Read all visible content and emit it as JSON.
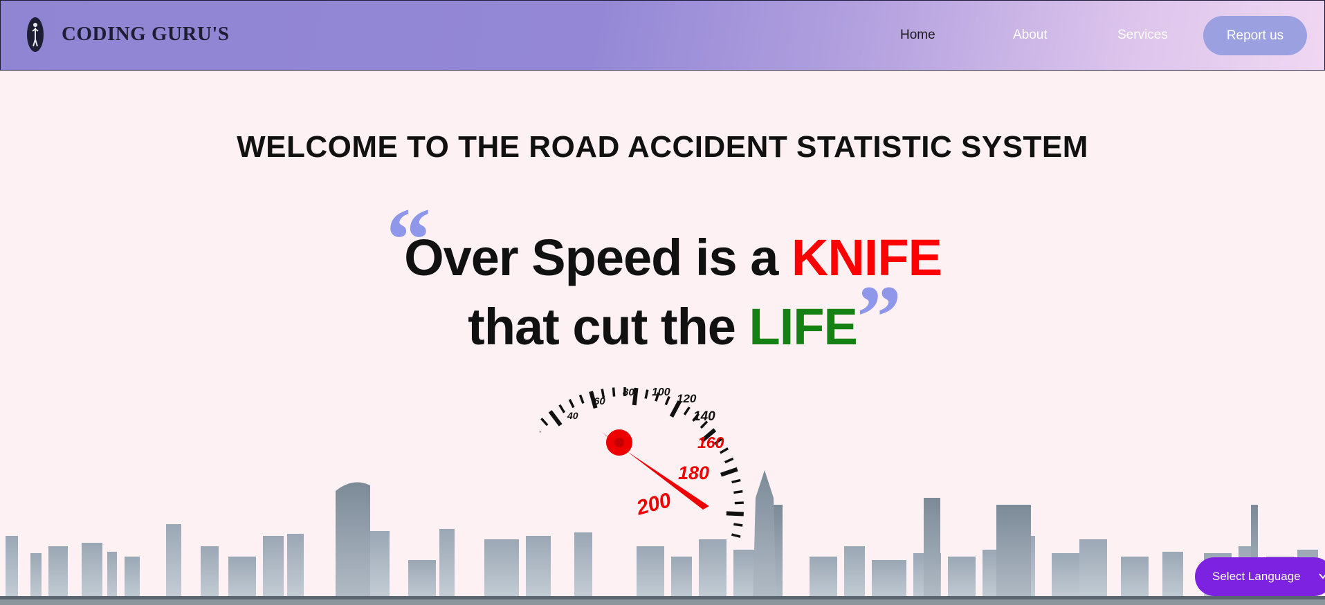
{
  "brand": {
    "name": "CODING GURU'S",
    "logo_icon": "guru-figure-icon"
  },
  "nav": {
    "links": [
      "Home",
      "About",
      "Services"
    ],
    "cta": "Report us"
  },
  "hero": {
    "heading": "WELCOME TO THE ROAD ACCIDENT STATISTIC SYSTEM",
    "quote_open": "“",
    "quote_close": "”",
    "line1_prefix": "Over Speed is a ",
    "line1_highlight": "KNIFE",
    "line2_prefix": "that cut the ",
    "line2_highlight": "LIFE"
  },
  "speedometer": {
    "labels": [
      "40",
      "60",
      "80",
      "100",
      "120",
      "140",
      "160",
      "180",
      "200"
    ]
  },
  "language": {
    "label": "Select Language",
    "icon": "chevron-down-icon"
  },
  "colors": {
    "accent_quote": "#8f97ea",
    "knife": "#ff0000",
    "life": "#158014",
    "language_button": "#7d22e0",
    "report_button": "#9aa0e0"
  }
}
